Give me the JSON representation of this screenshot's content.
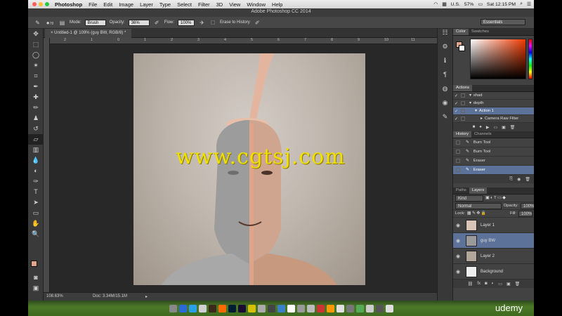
{
  "menubar": {
    "app": "Photoshop",
    "items": [
      "File",
      "Edit",
      "Image",
      "Layer",
      "Type",
      "Select",
      "Filter",
      "3D",
      "View",
      "Window",
      "Help"
    ],
    "right": {
      "locale": "U.S.",
      "battery": "57%",
      "clock": "Sat 12:15 PM"
    }
  },
  "optbar": {
    "window_title": "Adobe Photoshop CC 2014"
  },
  "options": {
    "brush_size": "78",
    "mode_label": "Mode:",
    "mode_value": "Brush",
    "opacity_label": "Opacity:",
    "opacity_value": "36%",
    "flow_label": "Flow:",
    "flow_value": "100%",
    "erase_history": "Erase to History",
    "workspace": "Essentials"
  },
  "doc": {
    "tab": "Untitled-1 @ 109% (guy BW, RGB/8) *",
    "ruler": [
      "2",
      "1",
      "0",
      "1",
      "2",
      "3",
      "4",
      "5",
      "6",
      "7",
      "8",
      "9",
      "10",
      "11"
    ],
    "watermark": "www.cgtsj.com",
    "zoom": "108.63%",
    "docsize": "Doc: 3.34M/15.1M"
  },
  "panels": {
    "color_tab": "Color",
    "swatches_tab": "Swatches",
    "actions_tab": "Actions",
    "actions": [
      {
        "check": "✓",
        "label": "shad",
        "indent": 0
      },
      {
        "check": "✓",
        "label": "depth",
        "indent": 0
      },
      {
        "check": "✓",
        "label": "Action 1",
        "indent": 1,
        "selected": true
      },
      {
        "check": "✓",
        "label": "Camera Raw Filter",
        "indent": 2
      }
    ],
    "history_tab": "History",
    "channels_tab": "Channels",
    "history": [
      {
        "label": "Burn Tool"
      },
      {
        "label": "Burn Tool"
      },
      {
        "label": "Eraser"
      },
      {
        "label": "Eraser",
        "selected": true
      }
    ],
    "paths_tab": "Paths",
    "layers_tab": "Layers",
    "kind": "Kind",
    "blend": "Normal",
    "opacity_label": "Opacity:",
    "opacity": "100%",
    "lock_label": "Lock:",
    "fill_label": "Fill:",
    "fill": "100%",
    "layers": [
      {
        "name": "Layer 1",
        "color": "#d9c4b8"
      },
      {
        "name": "guy BW",
        "color": "#9a9a9a",
        "selected": true
      },
      {
        "name": "Layer 2",
        "color": "#b3a79c"
      },
      {
        "name": "Background",
        "color": "#eeeeee"
      }
    ]
  },
  "fg_color": "#e0a58a",
  "bg_color": "#ffffff",
  "watermark_color": "#f0e000",
  "udemy": "udemy"
}
